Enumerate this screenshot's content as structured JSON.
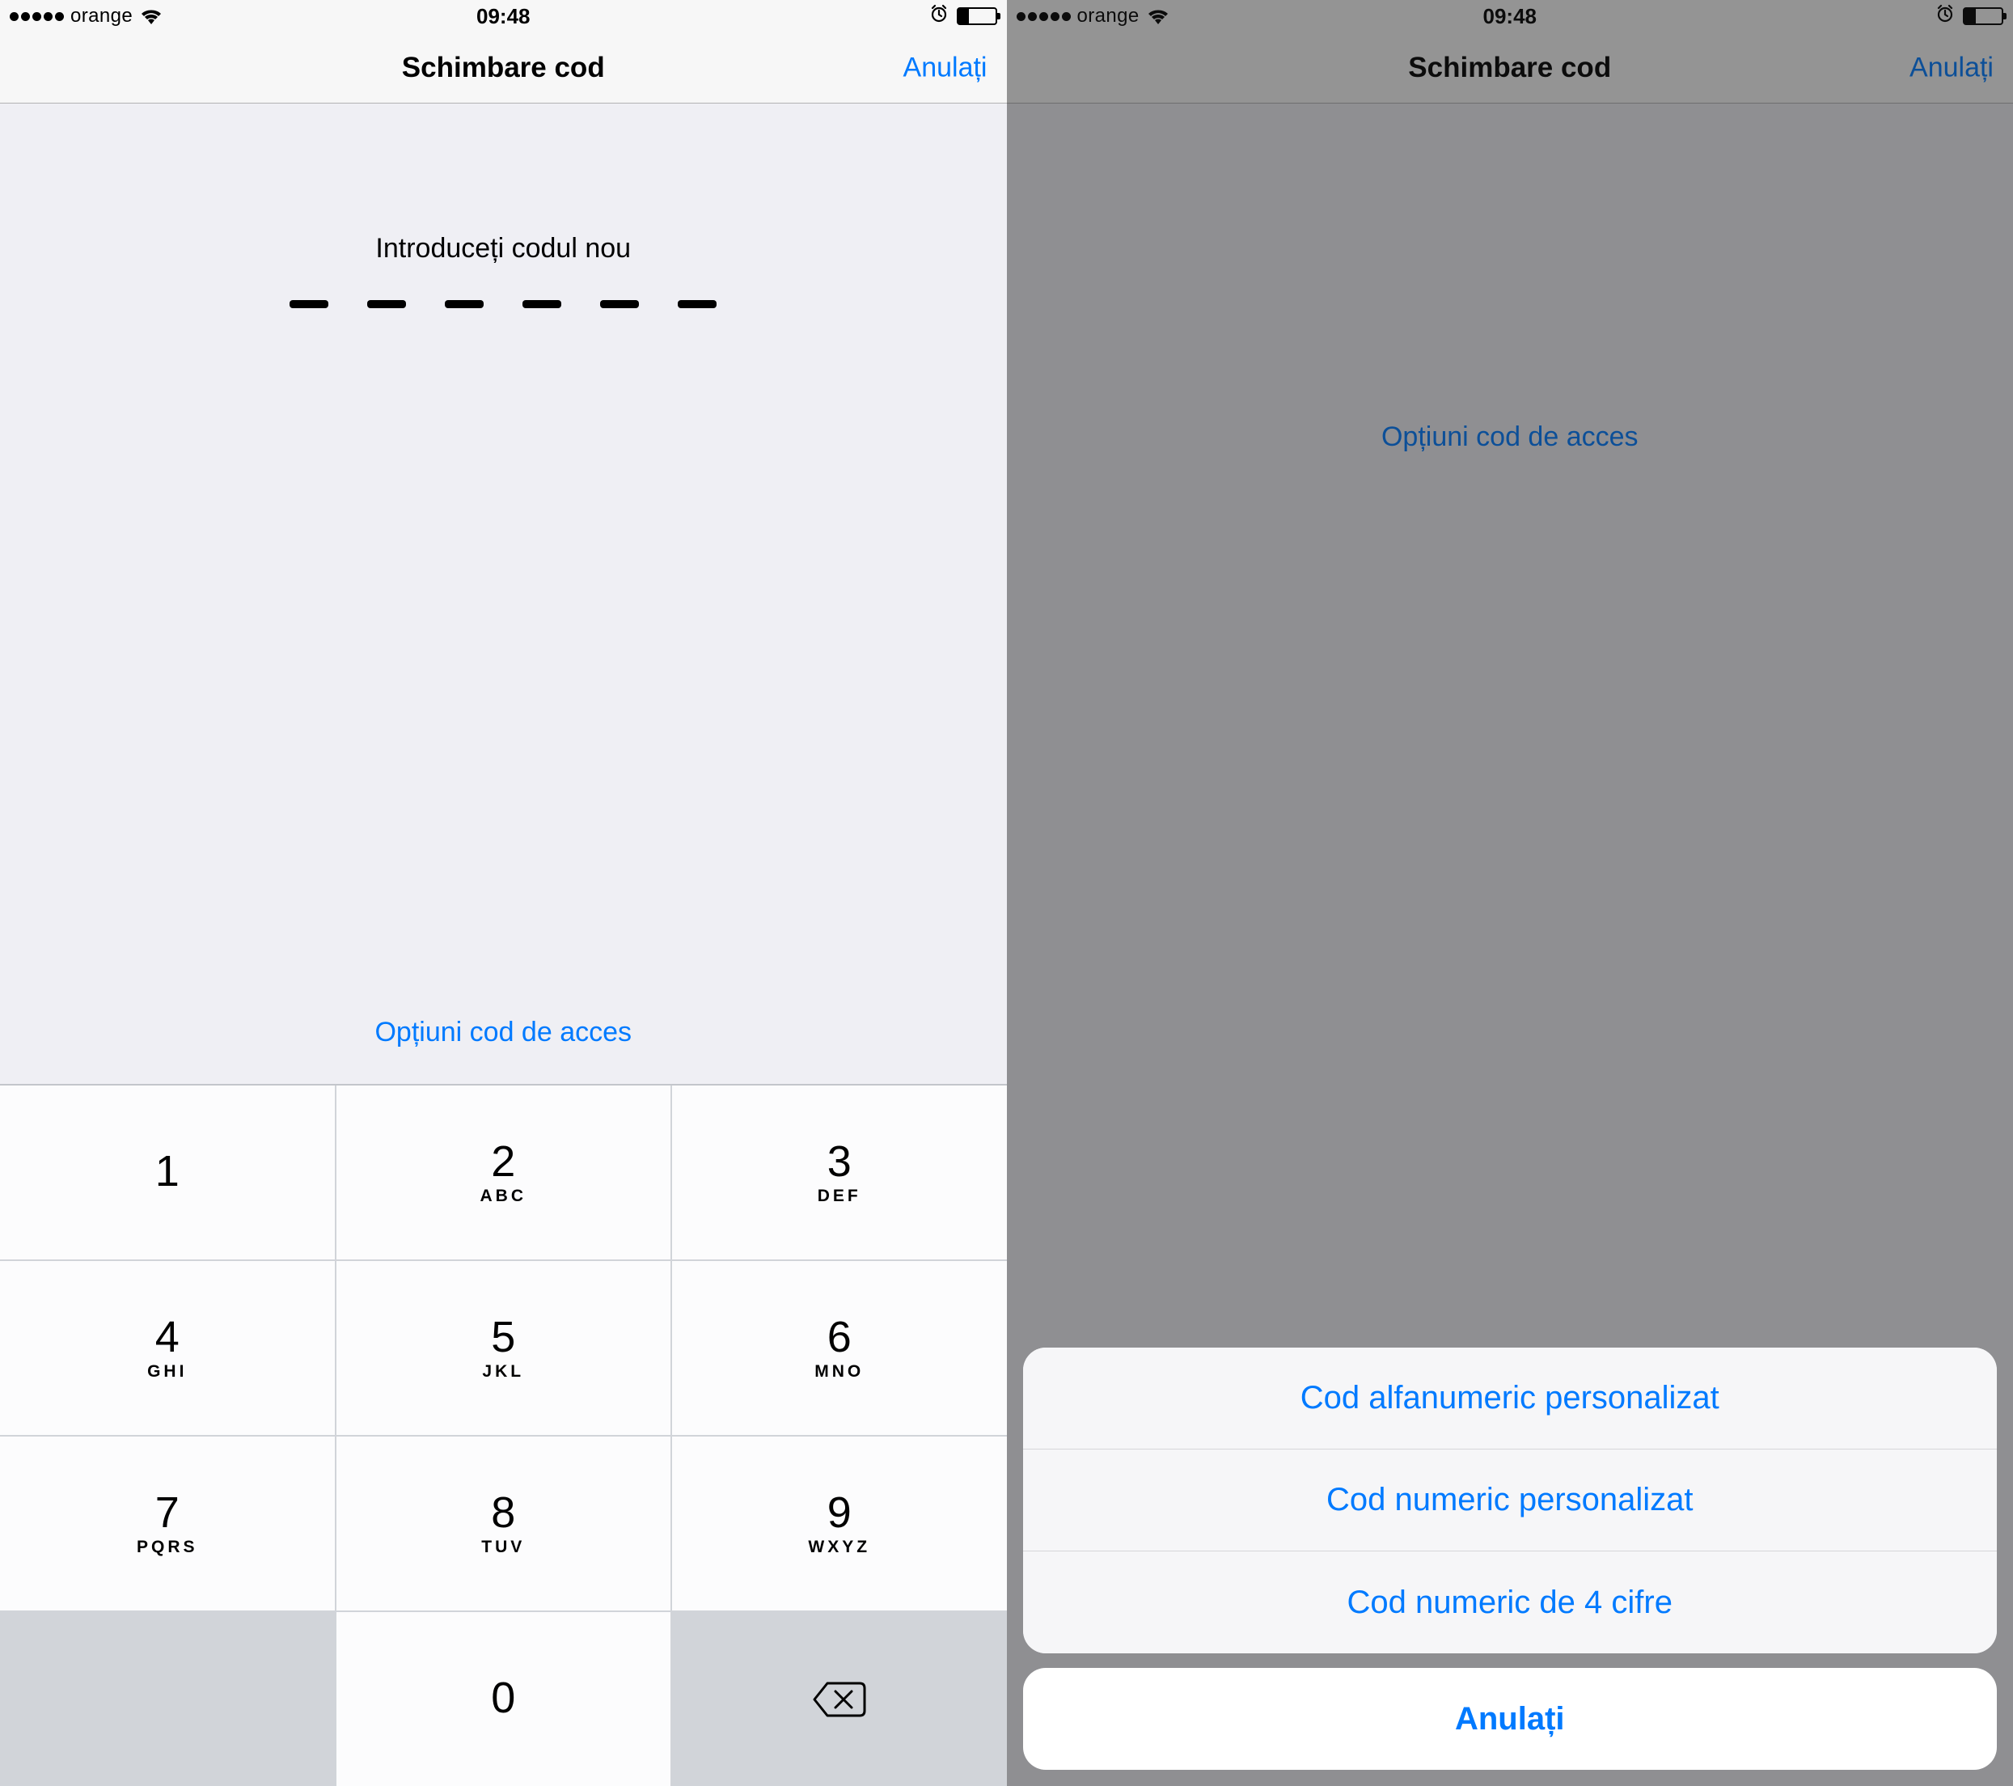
{
  "status": {
    "carrier": "orange",
    "time": "09:48"
  },
  "nav": {
    "title": "Schimbare cod",
    "cancel": "Anulați"
  },
  "content": {
    "prompt": "Introduceți codul nou",
    "options_link": "Opțiuni cod de acces"
  },
  "keypad": {
    "keys": [
      {
        "num": "1",
        "letters": ""
      },
      {
        "num": "2",
        "letters": "ABC"
      },
      {
        "num": "3",
        "letters": "DEF"
      },
      {
        "num": "4",
        "letters": "GHI"
      },
      {
        "num": "5",
        "letters": "JKL"
      },
      {
        "num": "6",
        "letters": "MNO"
      },
      {
        "num": "7",
        "letters": "PQRS"
      },
      {
        "num": "8",
        "letters": "TUV"
      },
      {
        "num": "9",
        "letters": "WXYZ"
      },
      {
        "num": "0",
        "letters": ""
      }
    ]
  },
  "sheet": {
    "opt1": "Cod alfanumeric personalizat",
    "opt2": "Cod numeric personalizat",
    "opt3": "Cod numeric de 4 cifre",
    "cancel": "Anulați"
  }
}
